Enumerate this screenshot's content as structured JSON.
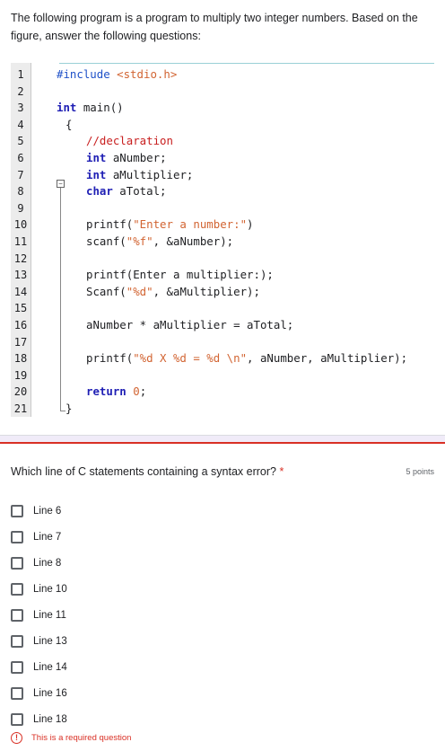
{
  "intro_text": "The following program is a program to multiply two integer numbers. Based on the figure, answer the following questions:",
  "code": {
    "lines": [
      {
        "n": "1",
        "segments": [
          {
            "c": "pp",
            "t": "#include "
          },
          {
            "c": "str",
            "t": "<stdio.h>"
          }
        ]
      },
      {
        "n": "2",
        "segments": []
      },
      {
        "n": "3",
        "segments": [
          {
            "c": "kw",
            "t": "int"
          },
          {
            "c": "pl",
            "t": " main()"
          }
        ]
      },
      {
        "n": "4",
        "segments": [
          {
            "c": "pl",
            "t": "{"
          }
        ]
      },
      {
        "n": "5",
        "segments": [
          {
            "c": "cm",
            "t": "//declaration"
          }
        ]
      },
      {
        "n": "6",
        "segments": [
          {
            "c": "kw",
            "t": "int"
          },
          {
            "c": "pl",
            "t": " aNumber;"
          }
        ]
      },
      {
        "n": "7",
        "segments": [
          {
            "c": "kw",
            "t": "int"
          },
          {
            "c": "pl",
            "t": " aMultiplier;"
          }
        ]
      },
      {
        "n": "8",
        "segments": [
          {
            "c": "kw",
            "t": "char"
          },
          {
            "c": "pl",
            "t": " aTotal;"
          }
        ]
      },
      {
        "n": "9",
        "segments": []
      },
      {
        "n": "10",
        "segments": [
          {
            "c": "pl",
            "t": "printf("
          },
          {
            "c": "str",
            "t": "\"Enter a number:\""
          },
          {
            "c": "pl",
            "t": ")"
          }
        ]
      },
      {
        "n": "11",
        "segments": [
          {
            "c": "pl",
            "t": "scanf("
          },
          {
            "c": "str",
            "t": "\"%f\""
          },
          {
            "c": "pl",
            "t": ", &aNumber);"
          }
        ]
      },
      {
        "n": "12",
        "segments": []
      },
      {
        "n": "13",
        "segments": [
          {
            "c": "pl",
            "t": "printf(Enter a multiplier:);"
          }
        ]
      },
      {
        "n": "14",
        "segments": [
          {
            "c": "pl",
            "t": "Scanf("
          },
          {
            "c": "str",
            "t": "\"%d\""
          },
          {
            "c": "pl",
            "t": ", &aMultiplier);"
          }
        ]
      },
      {
        "n": "15",
        "segments": []
      },
      {
        "n": "16",
        "segments": [
          {
            "c": "pl",
            "t": "aNumber * aMultiplier = aTotal;"
          }
        ]
      },
      {
        "n": "17",
        "segments": []
      },
      {
        "n": "18",
        "segments": [
          {
            "c": "pl",
            "t": "printf("
          },
          {
            "c": "str",
            "t": "\"%d X %d = %d \\n\""
          },
          {
            "c": "pl",
            "t": ", aNumber, aMultiplier);"
          }
        ]
      },
      {
        "n": "19",
        "segments": []
      },
      {
        "n": "20",
        "segments": [
          {
            "c": "kw",
            "t": "return"
          },
          {
            "c": "pl",
            "t": " "
          },
          {
            "c": "num",
            "t": "0"
          },
          {
            "c": "pl",
            "t": ";"
          }
        ]
      },
      {
        "n": "21",
        "segments": [
          {
            "c": "pl",
            "t": "}"
          }
        ]
      }
    ]
  },
  "question": {
    "text": "Which line of C statements containing a syntax error?",
    "required_marker": "*",
    "points": "5 points"
  },
  "options": [
    "Line 6",
    "Line 7",
    "Line 8",
    "Line 10",
    "Line 11",
    "Line 13",
    "Line 14",
    "Line 16",
    "Line 18"
  ],
  "error_message": "This is a required question",
  "colors": {
    "accent": "#d93025",
    "keyword": "#1e1eb4",
    "string": "#d26432",
    "comment": "#c81e1e"
  }
}
